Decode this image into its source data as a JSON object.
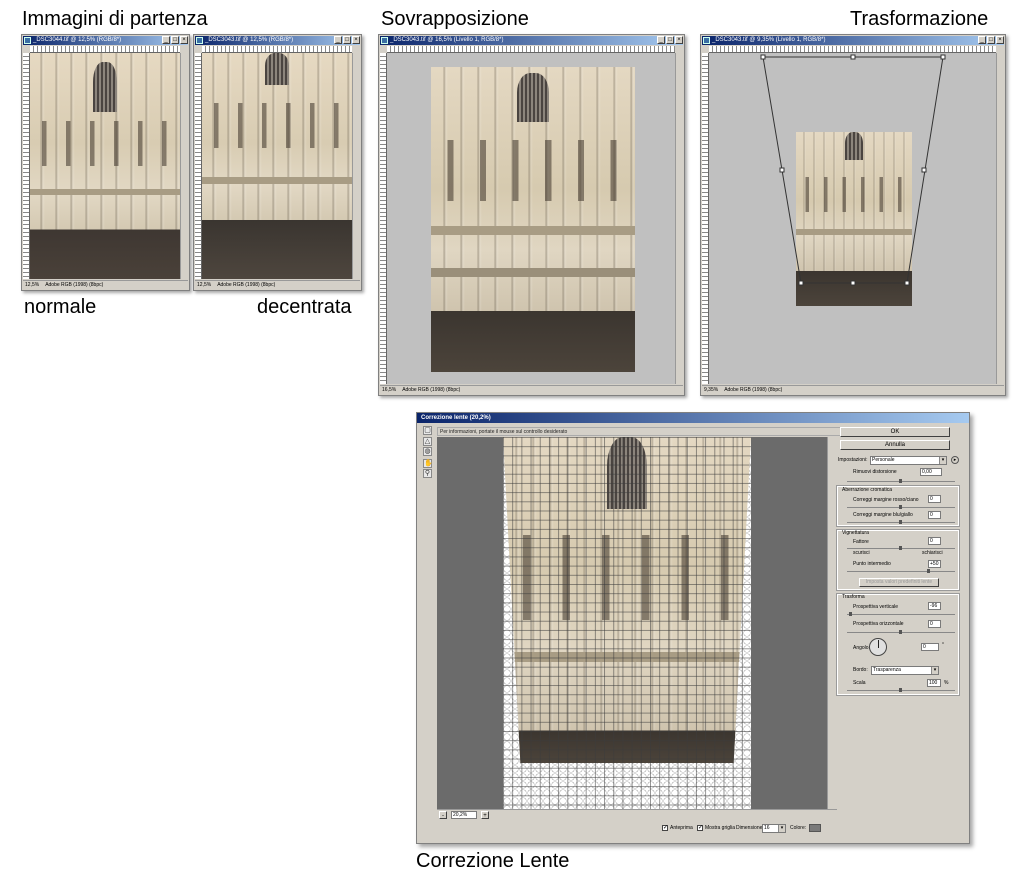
{
  "captions": {
    "immagini": "Immagini di partenza",
    "sovrapposizione": "Sovrapposizione",
    "trasformazione": "Trasformazione",
    "normale": "normale",
    "decentrata": "decentrata",
    "correzione": "Correzione Lente"
  },
  "windows": {
    "win1": {
      "title": "_DSC3044.tif @ 12,5% (RGB/8*)",
      "zoom": "12,5%",
      "doc": "Adobe RGB (1998) (8bpc)"
    },
    "win2": {
      "title": "_DSC3043.tif @ 12,5% (RGB/8*)",
      "zoom": "12,5%",
      "doc": "Adobe RGB (1998) (8bpc)"
    },
    "win3": {
      "title": "_DSC3043.tif @ 16,5% (Livello 1, RGB/8*)",
      "zoom": "16,5%",
      "doc": "Adobe RGB (1998) (8bpc)"
    },
    "win4": {
      "title": "_DSC3043.tif @ 9,35% (Livello 1, RGB/8*)",
      "zoom": "9,35%",
      "doc": "Adobe RGB (1998) (8bpc)"
    }
  },
  "lens": {
    "title": "Correzione lente (20,2%)",
    "hint": "Per informazioni, portate il mouse sul controllo desiderato",
    "zoom": "20,2%",
    "ok": "OK",
    "annulla": "Annulla",
    "impostazioni_label": "Impostazioni:",
    "impostazioni_value": "Personale",
    "rimuovi_label": "Rimuovi distorsione",
    "rimuovi_value": "0,00",
    "aberrazione_title": "Aberrazione cromatica",
    "rosso_label": "Correggi margine rosso/ciano",
    "rosso_value": "0",
    "blu_label": "Correggi margine blu/giallo",
    "blu_value": "0",
    "vignettatura_title": "Vignettatura",
    "fattore_label": "Fattore",
    "fattore_value": "0",
    "scurisci": "scurisci",
    "schiarisci": "schiarisci",
    "punto_label": "Punto intermedio",
    "punto_value": "+50",
    "imposta_btn": "Imposta valori predefiniti lente",
    "trasforma_title": "Trasforma",
    "prosp_v_label": "Prospettiva verticale",
    "prosp_v_value": "-96",
    "prosp_o_label": "Prospettiva orizzontale",
    "prosp_o_value": "0",
    "angolo_label": "Angolo:",
    "angolo_value": "0",
    "angolo_unit": "°",
    "bordo_label": "Bordo:",
    "bordo_value": "Trasparenza",
    "scala_label": "Scala",
    "scala_value": "100",
    "scala_unit": "%",
    "anteprima": "Anteprima",
    "mostra_griglia": "Mostra griglia",
    "dimensione_label": "Dimensione:",
    "dimensione_value": "16",
    "colore_label": "Colore:",
    "colore_value": "#7a7a7a"
  }
}
